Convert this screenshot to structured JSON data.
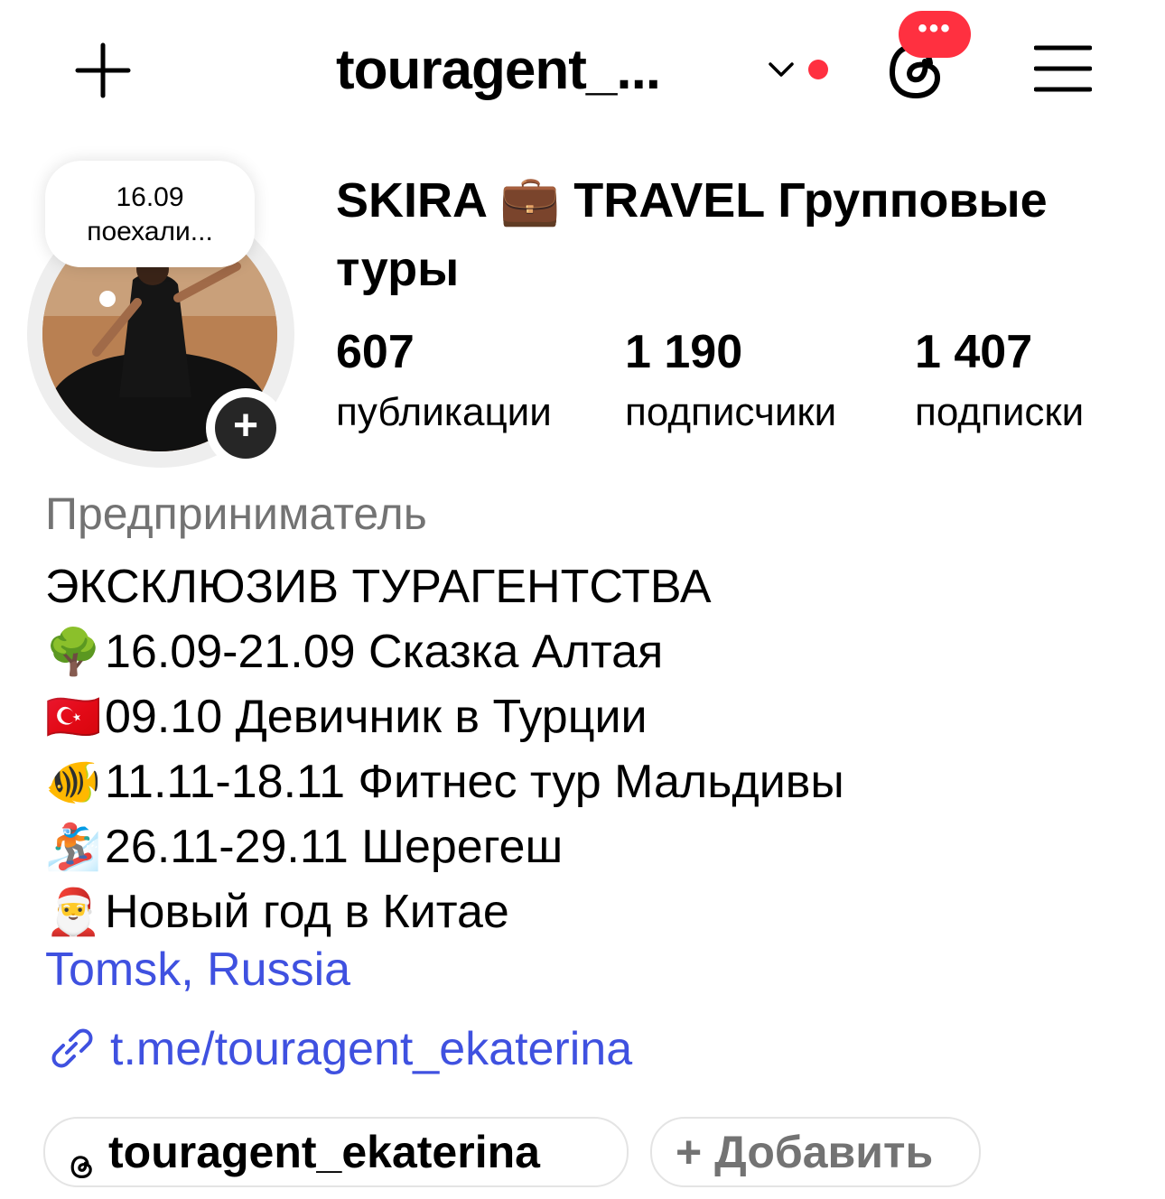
{
  "header": {
    "username": "touragent_...",
    "threads_badge": "•••",
    "has_notification_dot": true
  },
  "avatar": {
    "note_line1": "16.09",
    "note_line2": "поехали...",
    "add_story": "+"
  },
  "profile": {
    "full_name": "SKIRA 💼 TRAVEL Групповые туры"
  },
  "stats": [
    {
      "count": "607",
      "label": "публикации"
    },
    {
      "count": "1 190",
      "label": "подписчики"
    },
    {
      "count": "1 407",
      "label": "подписки"
    }
  ],
  "bio": {
    "category": "Предприниматель",
    "headline": "ЭКСКЛЮЗИВ ТУРАГЕНТСТВА",
    "lines": [
      {
        "emoji": "🌳",
        "text": "16.09-21.09 Сказка Алтая"
      },
      {
        "emoji": "🇹🇷",
        "text": "09.10 Девичник в Турции"
      },
      {
        "emoji": "🐠",
        "text": "11.11-18.11 Фитнес тур Мальдивы"
      },
      {
        "emoji": "🏂",
        "text": "26.11-29.11 Шерегеш"
      },
      {
        "emoji": "🎅",
        "text": "Новый год в Китае"
      }
    ],
    "location": "Tomsk, Russia",
    "link": "t.me/touragent_ekaterina"
  },
  "pills": {
    "threads_handle": "touragent_ekaterina",
    "add_label": "+ Добавить"
  },
  "colors": {
    "accent_link": "#3f51e0",
    "notification_red": "#ff3040",
    "muted": "#737373"
  }
}
